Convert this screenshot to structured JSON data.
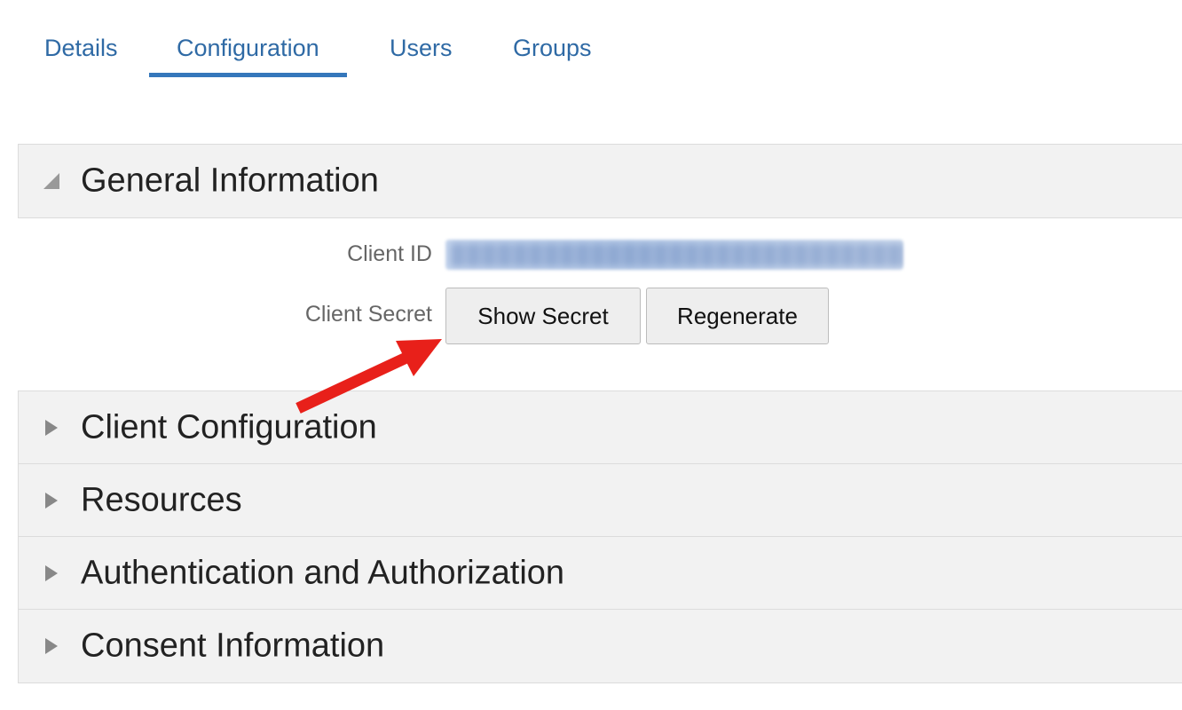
{
  "tabs": [
    {
      "label": "Details",
      "active": false
    },
    {
      "label": "Configuration",
      "active": true
    },
    {
      "label": "Users",
      "active": false
    },
    {
      "label": "Groups",
      "active": false
    }
  ],
  "sections": {
    "general": {
      "title": "General Information",
      "expanded": true
    },
    "client_configuration": {
      "title": "Client Configuration",
      "expanded": false
    },
    "resources": {
      "title": "Resources",
      "expanded": false
    },
    "authn_authz": {
      "title": "Authentication and Authorization",
      "expanded": false
    },
    "consent": {
      "title": "Consent Information",
      "expanded": false
    }
  },
  "general_info": {
    "client_id_label": "Client ID",
    "client_secret_label": "Client Secret",
    "show_secret_label": "Show Secret",
    "regenerate_label": "Regenerate"
  },
  "colors": {
    "accent": "#3577bb",
    "tab_text": "#2f6aa5",
    "section_bg": "#f2f2f2",
    "annotation_arrow": "#e8201a"
  },
  "icons": {
    "expanded": "caret-down-icon",
    "collapsed": "caret-right-icon",
    "annotation": "red-arrow-icon"
  }
}
